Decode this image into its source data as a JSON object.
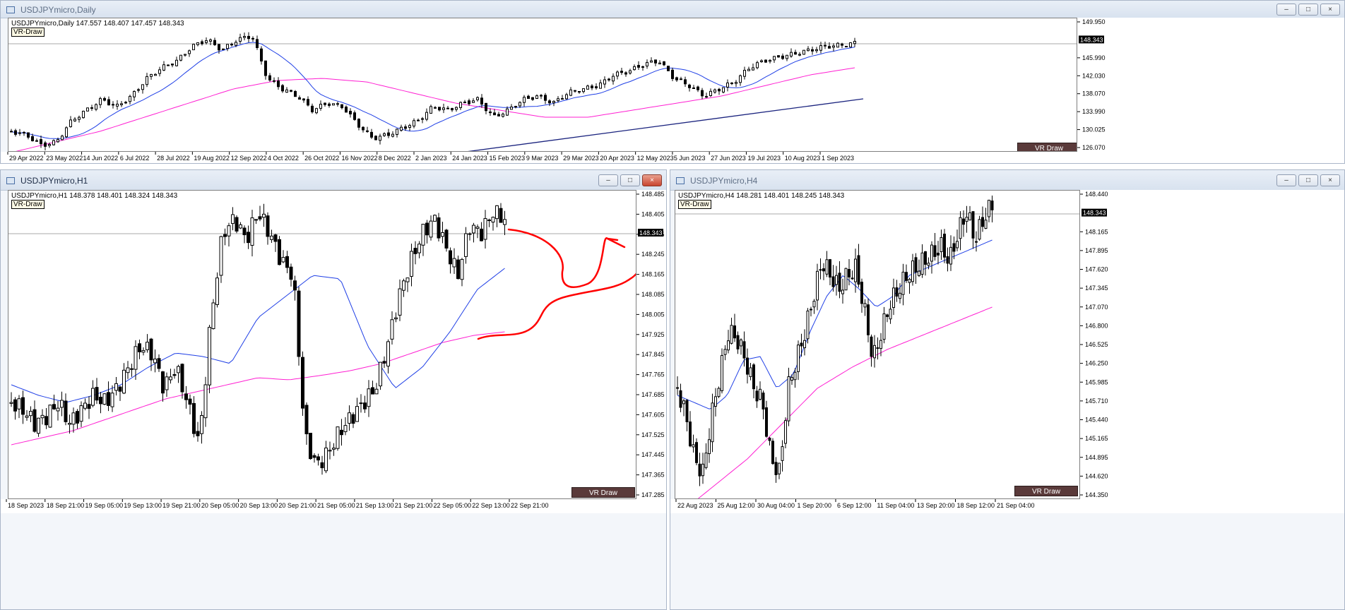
{
  "windows": {
    "daily": {
      "title": "USDJPYmicro,Daily",
      "header": "USDJPYmicro,Daily  147.557 148.407 147.457 148.343",
      "tag": "VR-Draw",
      "button": "VR Draw",
      "current_price": "148.343",
      "price_labels": [
        "149.950",
        "148.343",
        "145.990",
        "142.030",
        "138.070",
        "133.990",
        "130.025",
        "126.070"
      ],
      "time_labels": [
        "29 Apr 2022",
        "23 May 2022",
        "14 Jun 2022",
        "6 Jul 2022",
        "28 Jul 2022",
        "19 Aug 2022",
        "12 Sep 2022",
        "4 Oct 2022",
        "26 Oct 2022",
        "16 Nov 2022",
        "8 Dec 2022",
        "2 Jan 2023",
        "24 Jan 2023",
        "15 Feb 2023",
        "9 Mar 2023",
        "29 Mar 2023",
        "20 Apr 2023",
        "12 May 2023",
        "5 Jun 2023",
        "27 Jun 2023",
        "19 Jul 2023",
        "10 Aug 2023",
        "1 Sep 2023"
      ],
      "colors": {
        "candle": "#000000",
        "ma_fast": "#1f3fe6",
        "ma_slow": "#ff1fd2",
        "trendline": "#1a237e",
        "grid": "#aaaaaa"
      }
    },
    "h1": {
      "title": "USDJPYmicro,H1",
      "header": "USDJPYmicro,H1  148.378 148.401 148.324 148.343",
      "tag": "VR-Draw",
      "button": "VR Draw",
      "current_price": "148.343",
      "price_labels": [
        "148.485",
        "148.405",
        "148.325",
        "148.245",
        "148.165",
        "148.085",
        "148.005",
        "147.925",
        "147.845",
        "147.765",
        "147.685",
        "147.605",
        "147.525",
        "147.445",
        "147.365",
        "147.285"
      ],
      "time_labels": [
        "18 Sep 2023",
        "18 Sep 21:00",
        "19 Sep 05:00",
        "19 Sep 13:00",
        "19 Sep 21:00",
        "20 Sep 05:00",
        "20 Sep 13:00",
        "20 Sep 21:00",
        "21 Sep 05:00",
        "21 Sep 13:00",
        "21 Sep 21:00",
        "22 Sep 05:00",
        "22 Sep 13:00",
        "22 Sep 21:00"
      ],
      "colors": {
        "candle": "#000000",
        "ma_fast": "#1f3fe6",
        "ma_slow": "#ff1fd2",
        "drawing": "#ff0000"
      }
    },
    "h4": {
      "title": "USDJPYmicro,H4",
      "header": "USDJPYmicro,H4  148.281 148.401 148.245 148.343",
      "tag": "VR-Draw",
      "button": "VR Draw",
      "current_price": "148.343",
      "price_labels": [
        "148.440",
        "148.343",
        "148.165",
        "147.895",
        "147.620",
        "147.345",
        "147.070",
        "146.800",
        "146.525",
        "146.250",
        "145.985",
        "145.710",
        "145.440",
        "145.165",
        "144.895",
        "144.620",
        "144.350"
      ],
      "time_labels": [
        "22 Aug 2023",
        "25 Aug 12:00",
        "30 Aug 04:00",
        "1 Sep 20:00",
        "6 Sep 12:00",
        "11 Sep 04:00",
        "13 Sep 20:00",
        "18 Sep 12:00",
        "21 Sep 04:00"
      ],
      "colors": {
        "candle": "#000000",
        "ma_fast": "#1f3fe6",
        "ma_slow": "#ff1fd2"
      }
    }
  },
  "window_buttons": {
    "minimize": "–",
    "maximize": "□",
    "close": "×"
  }
}
